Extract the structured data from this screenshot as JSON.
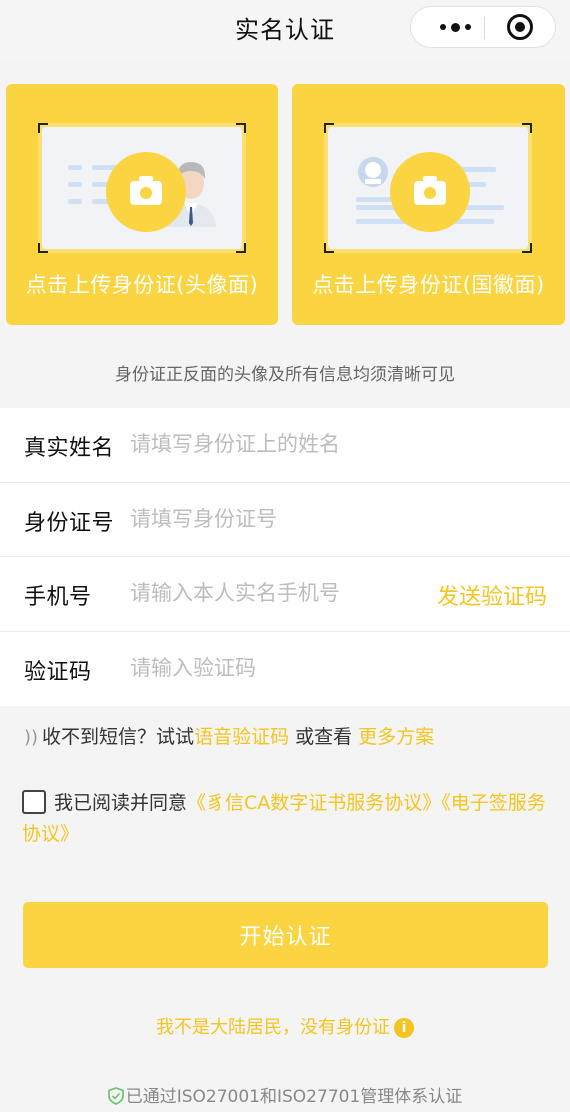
{
  "nav": {
    "title": "实名认证"
  },
  "upload": {
    "front_label": "点击上传身份证(头像面)",
    "back_label": "点击上传身份证(国徽面)"
  },
  "hint": "身份证正反面的头像及所有信息均须清晰可见",
  "form": {
    "name": {
      "label": "真实姓名",
      "placeholder": "请填写身份证上的姓名"
    },
    "id": {
      "label": "身份证号",
      "placeholder": "请填写身份证号"
    },
    "phone": {
      "label": "手机号",
      "placeholder": "请输入本人实名手机号",
      "send": "发送验证码"
    },
    "code": {
      "label": "验证码",
      "placeholder": "请输入验证码"
    }
  },
  "sms": {
    "prefix": "收不到短信？试试",
    "voice_link": "语音验证码",
    "middle": " 或查看 ",
    "more_link": "更多方案"
  },
  "agreement": {
    "text": "我已阅读并同意",
    "link1": "《豸信CA数字证书服务协议》",
    "link2": "《电子签服务协议》"
  },
  "start_button": "开始认证",
  "not_resident": "我不是大陆居民，没有身份证",
  "certification": "已通过ISO27001和ISO27701管理体系认证",
  "colors": {
    "accent": "#fbd441",
    "link": "#f5c51f"
  }
}
